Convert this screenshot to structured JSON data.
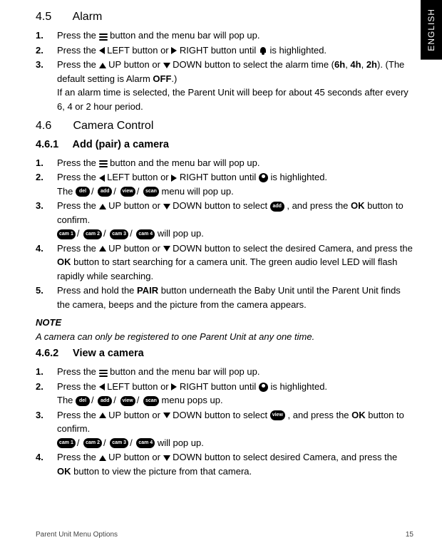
{
  "language_tab": "ENGLISH",
  "sec45": {
    "number": "4.5",
    "title": "Alarm",
    "steps": {
      "s1": {
        "n": "1.",
        "a": "Press the ",
        "b": " button and the menu bar will pop up."
      },
      "s2": {
        "n": "2.",
        "a": "Press the ",
        "left": " LEFT button or ",
        "right": " RIGHT button until ",
        "b": " is highlighted."
      },
      "s3": {
        "n": "3.",
        "a": "Press the ",
        "up": " UP button or ",
        "down": " DOWN button to select the alarm time (",
        "h6": "6h",
        "c1": ", ",
        "h4": "4h",
        "c2": ", ",
        "h2": "2h",
        "b": "). (The default setting is Alarm ",
        "off": "OFF",
        "d": ".)",
        "e": "If an alarm time is selected, the Parent Unit will beep for about 45 seconds after every 6, 4 or 2 hour period."
      }
    }
  },
  "sec46": {
    "number": "4.6",
    "title": "Camera Control"
  },
  "sec461": {
    "number": "4.6.1",
    "title": "Add (pair) a camera",
    "steps": {
      "s1": {
        "n": "1.",
        "a": "Press the ",
        "b": " button and the menu bar will pop up."
      },
      "s2": {
        "n": "2.",
        "a": "Press the ",
        "left": " LEFT button or ",
        "right": " RIGHT button until ",
        "b": " is highlighted.",
        "c": "The ",
        "d": " menu will pop up."
      },
      "s3": {
        "n": "3.",
        "a": "Press the ",
        "up": " UP button or ",
        "down": " DOWN button to select ",
        "b": " , and press the ",
        "ok": "OK",
        "c": " button to confirm.",
        "d": " will pop up."
      },
      "s4": {
        "n": "4.",
        "a": "Press the ",
        "up": " UP button or ",
        "down": " DOWN button to select the desired Camera, and press the ",
        "ok": "OK",
        "b": " button to start searching for a camera unit. The green audio level LED will flash rapidly while searching."
      },
      "s5": {
        "n": "5.",
        "a": "Press and hold the ",
        "pair": "PAIR",
        "b": " button underneath the Baby Unit until the Parent Unit finds the camera, beeps and the picture from the camera appears."
      }
    }
  },
  "note": {
    "head": "NOTE",
    "body": "A camera can only be registered to one Parent Unit at any one time."
  },
  "sec462": {
    "number": "4.6.2",
    "title": "View a camera",
    "steps": {
      "s1": {
        "n": "1.",
        "a": "Press the ",
        "b": " button and the menu bar will pop up."
      },
      "s2": {
        "n": "2.",
        "a": "Press the ",
        "left": " LEFT button or ",
        "right": " RIGHT button until ",
        "b": " is highlighted.",
        "c": "The ",
        "d": " menu pops up."
      },
      "s3": {
        "n": "3.",
        "a": "Press the ",
        "up": " UP button or ",
        "down": " DOWN button to select ",
        "b": " , and press the ",
        "ok": "OK",
        "c": " button to confirm.",
        "d": " will pop up."
      },
      "s4": {
        "n": "4.",
        "a": "Press the ",
        "up": " UP button or ",
        "down": " DOWN button to select desired Camera, and press the ",
        "ok": "OK",
        "b": " button to view the picture from that camera."
      }
    }
  },
  "pills": {
    "del": "del",
    "add": "add",
    "view": "view",
    "scan": "scan",
    "cam1": "cam 1",
    "cam2": "cam 2",
    "cam3": "cam 3",
    "cam4": "cam 4"
  },
  "footer": {
    "left": "Parent Unit Menu Options",
    "right": "15"
  }
}
